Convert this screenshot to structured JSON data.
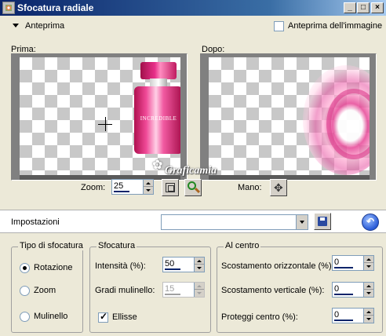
{
  "window": {
    "title": "Sfocatura radiale",
    "minimize_label": "_",
    "maximize_label": "□",
    "close_label": "×"
  },
  "preview": {
    "toggle_label": "Anteprima",
    "image_preview_label": "Anteprima dell'immagine",
    "image_preview_checked": false,
    "before_label": "Prima:",
    "after_label": "Dopo:",
    "product_text": "INCREDIBLE",
    "zoom_label": "Zoom:",
    "zoom_value": "25",
    "hand_label": "Mano:",
    "watermark_text": "Graficamia"
  },
  "settings": {
    "label": "Impostazioni",
    "preset_value": ""
  },
  "blur_type": {
    "legend": "Tipo di sfocatura",
    "options": [
      "Rotazione",
      "Zoom",
      "Mulinello"
    ],
    "selected": "Rotazione"
  },
  "blur": {
    "legend": "Sfocatura",
    "intensity_label": "Intensità (%):",
    "intensity_value": "50",
    "twirl_label": "Gradi mulinello:",
    "twirl_value": "15",
    "ellipse_label": "Ellisse",
    "ellipse_checked": true
  },
  "center": {
    "legend": "Al centro",
    "h_offset_label": "Scostamento orizzontale (%):",
    "h_offset_value": "0",
    "v_offset_label": "Scostamento verticale (%):",
    "v_offset_value": "0",
    "protect_label": "Proteggi centro (%):",
    "protect_value": "0"
  }
}
